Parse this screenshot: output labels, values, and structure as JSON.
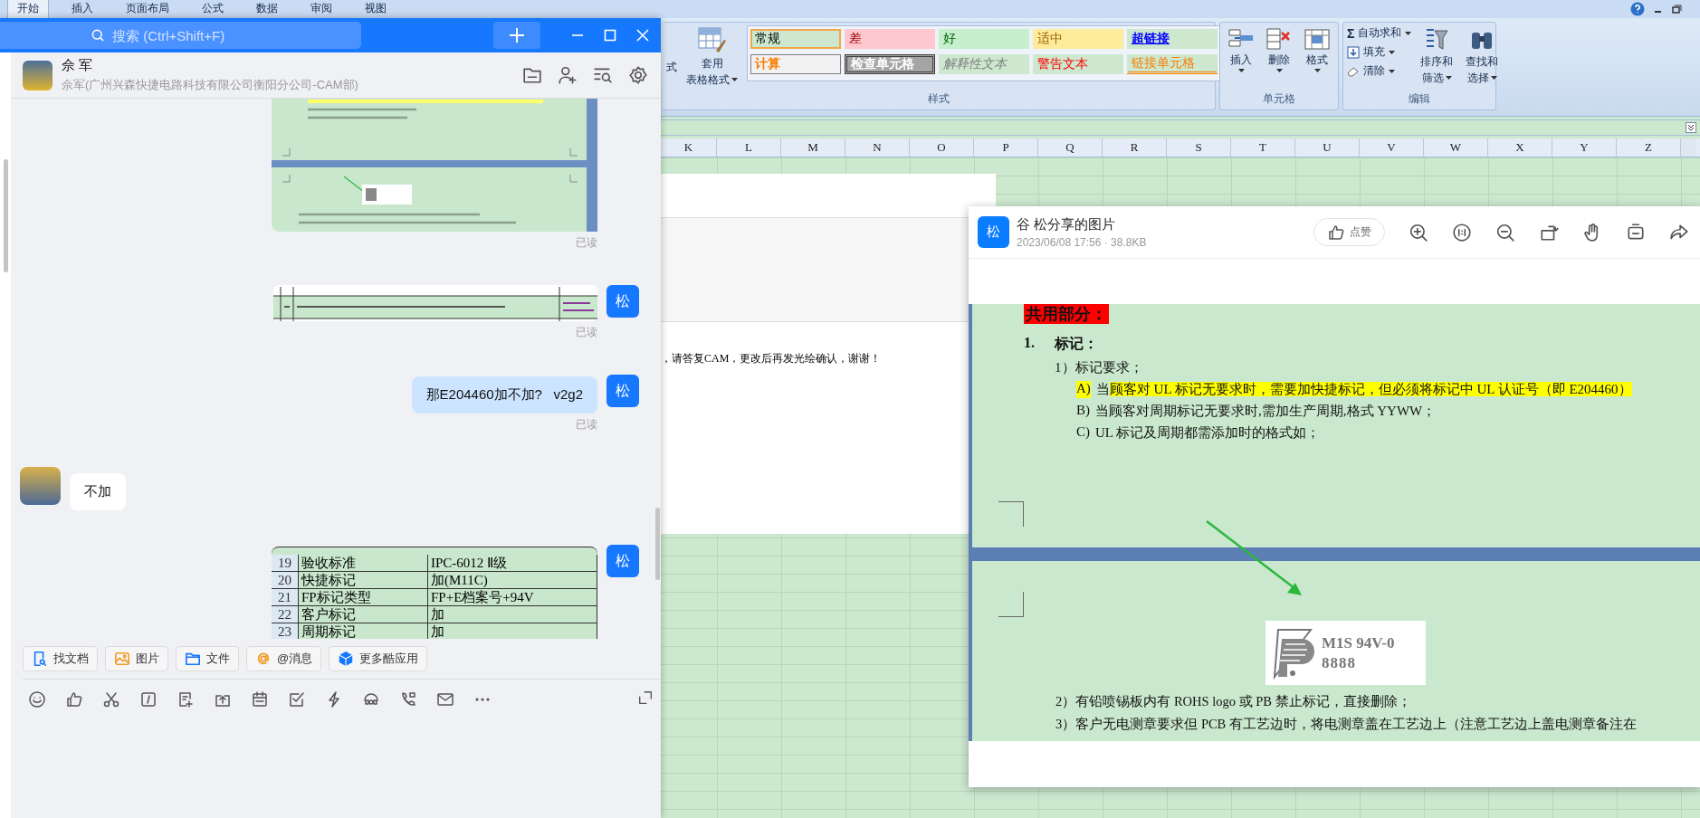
{
  "excel": {
    "tabs": [
      {
        "label": "开始",
        "selected": true
      },
      {
        "label": "插入",
        "selected": false
      },
      {
        "label": "页面布局",
        "selected": false
      },
      {
        "label": "公式",
        "selected": false
      },
      {
        "label": "数据",
        "selected": false
      },
      {
        "label": "审阅",
        "selected": false
      },
      {
        "label": "视图",
        "selected": false
      }
    ],
    "ribbon": {
      "cut_label": "式",
      "table_format_lines": [
        "套用",
        "表格格式"
      ],
      "styles_group": {
        "label": "样式",
        "styles": [
          {
            "label": "常规",
            "kind": "normal",
            "selected": true
          },
          {
            "label": "差",
            "kind": "bad",
            "selected": false
          },
          {
            "label": "好",
            "kind": "good",
            "selected": false
          },
          {
            "label": "适中",
            "kind": "neutral",
            "selected": false
          },
          {
            "label": "超链接",
            "kind": "hyperlink",
            "selected": false
          },
          {
            "label": "计算",
            "kind": "calculation",
            "selected": false
          },
          {
            "label": "检查单元格",
            "kind": "check",
            "selected": false
          },
          {
            "label": "解释性文本",
            "kind": "explanatory",
            "selected": false
          },
          {
            "label": "警告文本",
            "kind": "warning",
            "selected": false
          },
          {
            "label": "链接单元格",
            "kind": "linked",
            "selected": false
          }
        ]
      },
      "cells_group": {
        "label": "单元格",
        "buttons": [
          "插入",
          "删除",
          "格式"
        ]
      },
      "editing_group": {
        "label": "编辑",
        "autosum_symbol": "Σ",
        "items": [
          "自动求和",
          "填充",
          "清除"
        ],
        "buttons": [
          [
            "排序和",
            "筛选"
          ],
          [
            "查找和",
            "选择"
          ]
        ]
      }
    },
    "column_headers": [
      "K",
      "L",
      "M",
      "N",
      "O",
      "P",
      "Q",
      "R",
      "S",
      "T",
      "U",
      "V",
      "W",
      "X",
      "Y",
      "Z"
    ],
    "sheet_text": "，请答复CAM，更改后再发光绘确认，谢谢！"
  },
  "chat_window": {
    "search_placeholder": "搜索 (Ctrl+Shift+F)",
    "contact": {
      "name": "佘 军",
      "subtitle": "佘军(广州兴森快捷电路科技有限公司衡阳分公司-CAM部)"
    },
    "messages": [
      {
        "kind": "document_image",
        "read": "已读"
      },
      {
        "kind": "table_row_image",
        "avatar": "松",
        "read": "已读"
      },
      {
        "kind": "text",
        "from_me": true,
        "avatar": "松",
        "text": "那E204460加不加?   v2g2",
        "read": "已读"
      },
      {
        "kind": "text",
        "from_me": false,
        "text": "不加"
      },
      {
        "kind": "table_image",
        "avatar": "松",
        "rows": [
          [
            "19",
            "验收标准",
            "IPC-6012 Ⅱ级"
          ],
          [
            "20",
            "快捷标记",
            "加(M11C)"
          ],
          [
            "21",
            "FP标记类型",
            "FP+E档案号+94V"
          ],
          [
            "22",
            "客户标记",
            "加"
          ],
          [
            "23",
            "周期标记",
            "加"
          ]
        ]
      }
    ],
    "quick_apps": [
      "找文档",
      "图片",
      "文件",
      "@消息",
      "更多酷应用"
    ]
  },
  "image_viewer": {
    "avatar": "松",
    "title": "谷 松分享的图片",
    "meta": "2023/06/08 17:56 · 38.8KB",
    "like_label": "点赞",
    "document": {
      "heading": "共用部分：",
      "section_number": "1.",
      "section_title": "标记：",
      "subheading": "1）标记要求；",
      "lines": [
        {
          "marker": "A)",
          "marker_highlight": true,
          "segments": [
            {
              "text": "当",
              "highlight": false
            },
            {
              "text": "顾客对 UL 标记无要求时，需要加快捷标记，但必须将标记中 UL 认证号（即 E204460）",
              "highlight": true
            }
          ]
        },
        {
          "marker": "B)",
          "marker_highlight": false,
          "segments": [
            {
              "text": "当顾客对周期标记无要求时,需加生产周期,格式 YYWW；",
              "highlight": false
            }
          ]
        },
        {
          "marker": "C)",
          "marker_highlight": false,
          "segments": [
            {
              "text": "UL 标记及周期都需添加时的格式如；",
              "highlight": false
            }
          ]
        }
      ],
      "logo_lines": [
        "M1S 94V-0",
        "8888"
      ],
      "after_lines": [
        "2）有铅喷锡板内有 ROHS logo 或 PB 禁止标记，直接删除；",
        "3）客户无电测章要求但 PCB 有工艺边时，将电测章盖在工艺边上（注意工艺边上盖电测章备注在"
      ]
    }
  }
}
